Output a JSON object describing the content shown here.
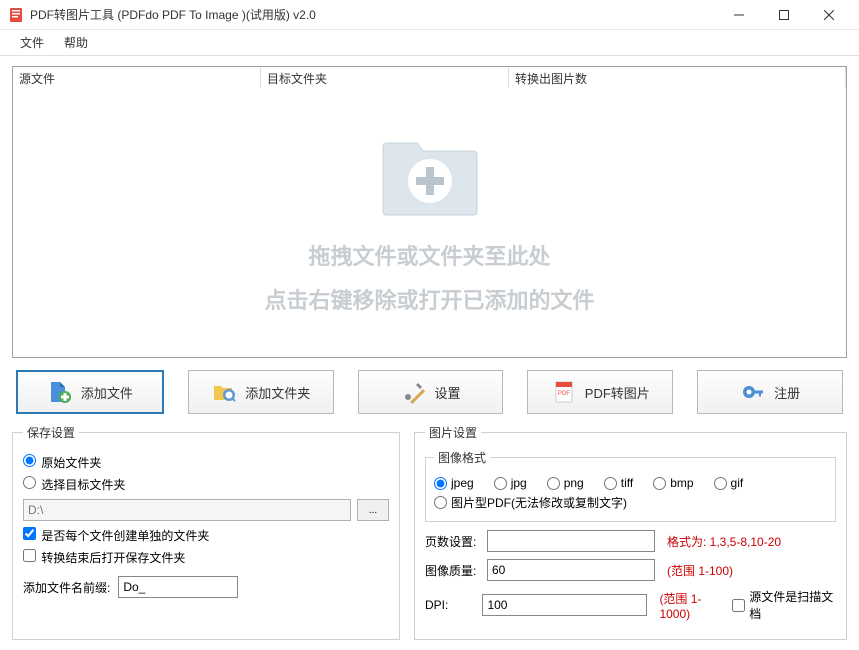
{
  "titlebar": {
    "title": "PDF转图片工具 (PDFdo PDF To Image )(试用版) v2.0"
  },
  "menu": {
    "file": "文件",
    "help": "帮助"
  },
  "columns": {
    "source": "源文件",
    "target": "目标文件夹",
    "count": "转换出图片数"
  },
  "dropzone": {
    "line1": "拖拽文件或文件夹至此处",
    "line2": "点击右键移除或打开已添加的文件"
  },
  "toolbar": {
    "add_file": "添加文件",
    "add_folder": "添加文件夹",
    "settings": "设置",
    "convert": "PDF转图片",
    "register": "注册"
  },
  "save": {
    "legend": "保存设置",
    "original_folder": "原始文件夹",
    "select_target": "选择目标文件夹",
    "path_value": "D:\\",
    "create_subfolder": "是否每个文件创建单独的文件夹",
    "open_after": "转换结束后打开保存文件夹",
    "prefix_label": "添加文件名前缀:",
    "prefix_value": "Do_"
  },
  "image": {
    "legend": "图片设置",
    "format_legend": "图像格式",
    "formats": {
      "jpeg": "jpeg",
      "jpg": "jpg",
      "png": "png",
      "tiff": "tiff",
      "bmp": "bmp",
      "gif": "gif"
    },
    "image_pdf": "图片型PDF(无法修改或复制文字)",
    "pages_label": "页数设置:",
    "pages_value": "",
    "pages_hint": "格式为: 1,3,5-8,10-20",
    "quality_label": "图像质量:",
    "quality_value": "60",
    "quality_hint": "(范围 1-100)",
    "dpi_label": "DPI:",
    "dpi_value": "100",
    "dpi_hint": "(范围 1-1000)",
    "scan_doc": "源文件是扫描文档"
  }
}
